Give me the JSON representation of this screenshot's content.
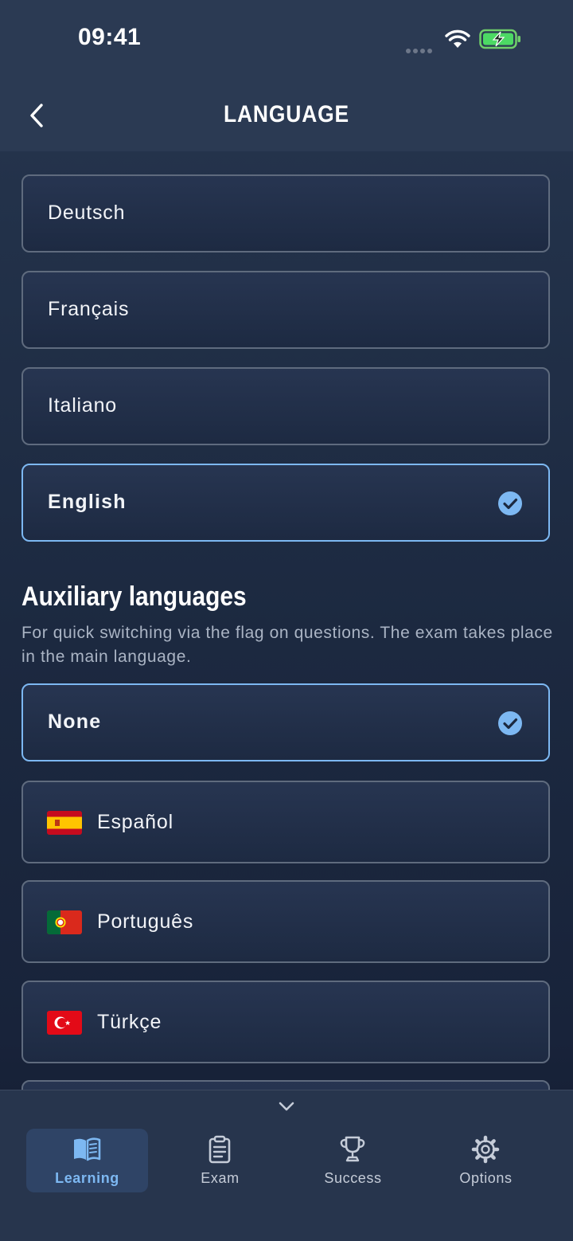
{
  "status_bar": {
    "time": "09:41"
  },
  "nav": {
    "title": "LANGUAGE",
    "back_icon": "chevron-left-icon"
  },
  "main_languages": [
    {
      "label": "Deutsch",
      "selected": false
    },
    {
      "label": "Français",
      "selected": false
    },
    {
      "label": "Italiano",
      "selected": false
    },
    {
      "label": "English",
      "selected": true
    }
  ],
  "auxiliary": {
    "title": "Auxiliary languages",
    "description": "For quick switching via the flag on questions. The exam takes place in the main language.",
    "options": [
      {
        "label": "None",
        "selected": true,
        "flag": ""
      },
      {
        "label": "Español",
        "selected": false,
        "flag": "spain-flag-icon"
      },
      {
        "label": "Português",
        "selected": false,
        "flag": "portugal-flag-icon"
      },
      {
        "label": "Türkçe",
        "selected": false,
        "flag": "turkey-flag-icon"
      }
    ]
  },
  "tab_bar": {
    "tabs": [
      {
        "label": "Learning",
        "icon": "book-icon",
        "active": true
      },
      {
        "label": "Exam",
        "icon": "clipboard-icon",
        "active": false
      },
      {
        "label": "Success",
        "icon": "trophy-icon",
        "active": false
      },
      {
        "label": "Options",
        "icon": "gear-icon",
        "active": false
      }
    ]
  },
  "colors": {
    "accent": "#7db8f2",
    "background": "#1c2940",
    "card_border": "#5f6b7e"
  }
}
